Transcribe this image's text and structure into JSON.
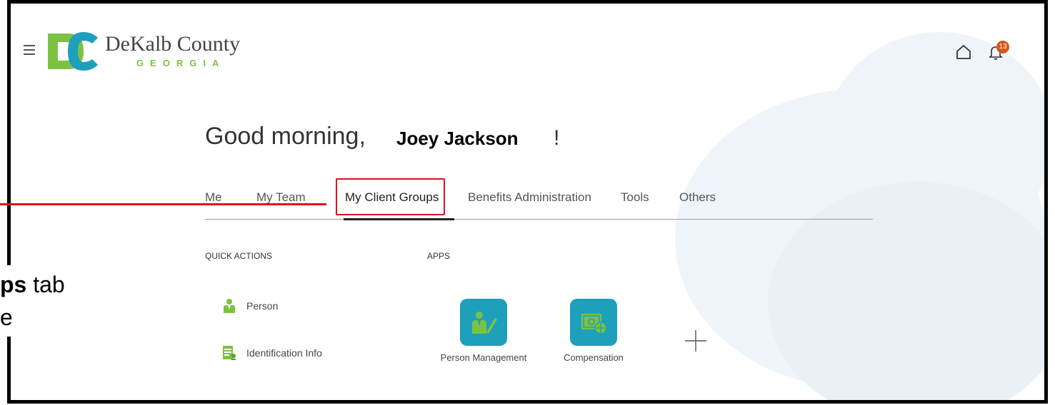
{
  "header": {
    "org_name": "DeKalb County",
    "org_sub": "GEORGIA",
    "notification_count": "13"
  },
  "greeting": {
    "text": "Good morning,",
    "name": "Joey Jackson",
    "tail": "!"
  },
  "tabs": [
    {
      "label": "Me"
    },
    {
      "label": "My Team"
    },
    {
      "label": "My Client Groups"
    },
    {
      "label": "Benefits Administration"
    },
    {
      "label": "Tools"
    },
    {
      "label": "Others"
    }
  ],
  "quick_actions": {
    "title": "QUICK ACTIONS",
    "items": [
      {
        "label": "Person",
        "icon": "person-icon"
      },
      {
        "label": "Identification Info",
        "icon": "id-document-icon"
      }
    ]
  },
  "apps": {
    "title": "APPS",
    "items": [
      {
        "label": "Person Management",
        "icon": "person-edit-icon"
      },
      {
        "label": "Compensation",
        "icon": "money-icon"
      }
    ],
    "add_label": "add-app-icon"
  },
  "callout": {
    "bold": "ps",
    "line1_rest": " tab",
    "line2": "e"
  },
  "colors": {
    "accent_red": "#e0101e",
    "app_tile": "#1e9fbc",
    "green": "#7cc242",
    "badge": "#d15a1b"
  }
}
